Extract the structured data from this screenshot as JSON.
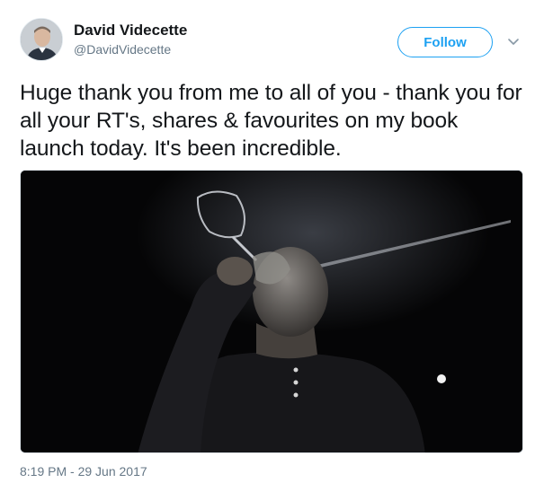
{
  "author": {
    "display_name": "David Videcette",
    "handle": "@DavidVidecette"
  },
  "actions": {
    "follow_label": "Follow",
    "more_icon": "chevron-down-icon"
  },
  "tweet": {
    "text": "Huge thank you from me to all of you - thank you for all your RT's, shares & favourites on my book launch today. It's been incredible.",
    "timestamp": "8:19 PM - 29 Jun 2017"
  },
  "colors": {
    "accent": "#1da1f2",
    "text": "#14171a",
    "secondary_text": "#657786"
  }
}
